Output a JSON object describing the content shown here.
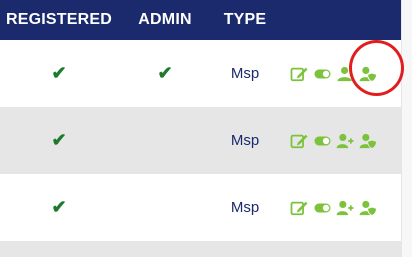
{
  "header": {
    "registered": "REGISTERED",
    "admin": "ADMIN",
    "type": "TYPE"
  },
  "rows": [
    {
      "registered": "✔",
      "admin": "✔",
      "type": "Msp",
      "actions": [
        "edit-icon",
        "toggle-icon",
        "user-icon",
        "user-shield-icon"
      ]
    },
    {
      "registered": "✔",
      "admin": "",
      "type": "Msp",
      "actions": [
        "edit-icon",
        "toggle-icon",
        "user-plus-icon",
        "user-shield-icon"
      ]
    },
    {
      "registered": "✔",
      "admin": "",
      "type": "Msp",
      "actions": [
        "edit-icon",
        "toggle-icon",
        "user-plus-icon",
        "user-shield-icon"
      ]
    }
  ],
  "colors": {
    "header_bg": "#1a2a6c",
    "check": "#1e7a2c",
    "action_icons": "#7cc23a",
    "highlight_circle": "#e21d1d"
  }
}
